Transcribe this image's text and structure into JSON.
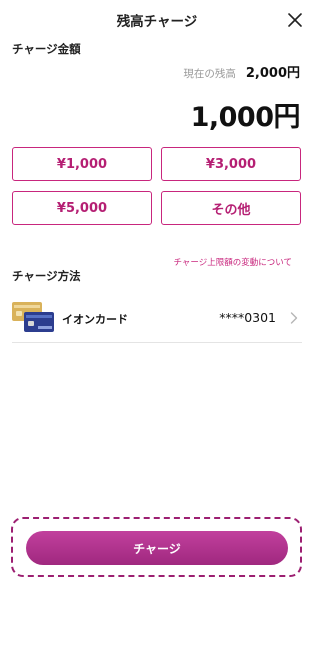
{
  "header": {
    "title": "残高チャージ",
    "close_icon": "close-icon"
  },
  "charge_amount": {
    "label": "チャージ金額",
    "balance_label": "現在の残高",
    "balance_value": "2,000円",
    "selected_amount": "1,000円"
  },
  "amount_options": [
    "¥1,000",
    "¥3,000",
    "¥5,000",
    "その他"
  ],
  "limit_link": "チャージ上限額の変動について",
  "payment_method": {
    "label": "チャージ方法",
    "card_name": "イオンカード",
    "card_number": "****0301",
    "card_icon": "credit-card-icon",
    "chevron_icon": "chevron-right-icon"
  },
  "cta": {
    "label": "チャージ"
  },
  "colors": {
    "accent": "#c8267d",
    "cta_top": "#c2409d",
    "cta_bottom": "#a0287f",
    "highlight_border": "#9c1f71"
  }
}
